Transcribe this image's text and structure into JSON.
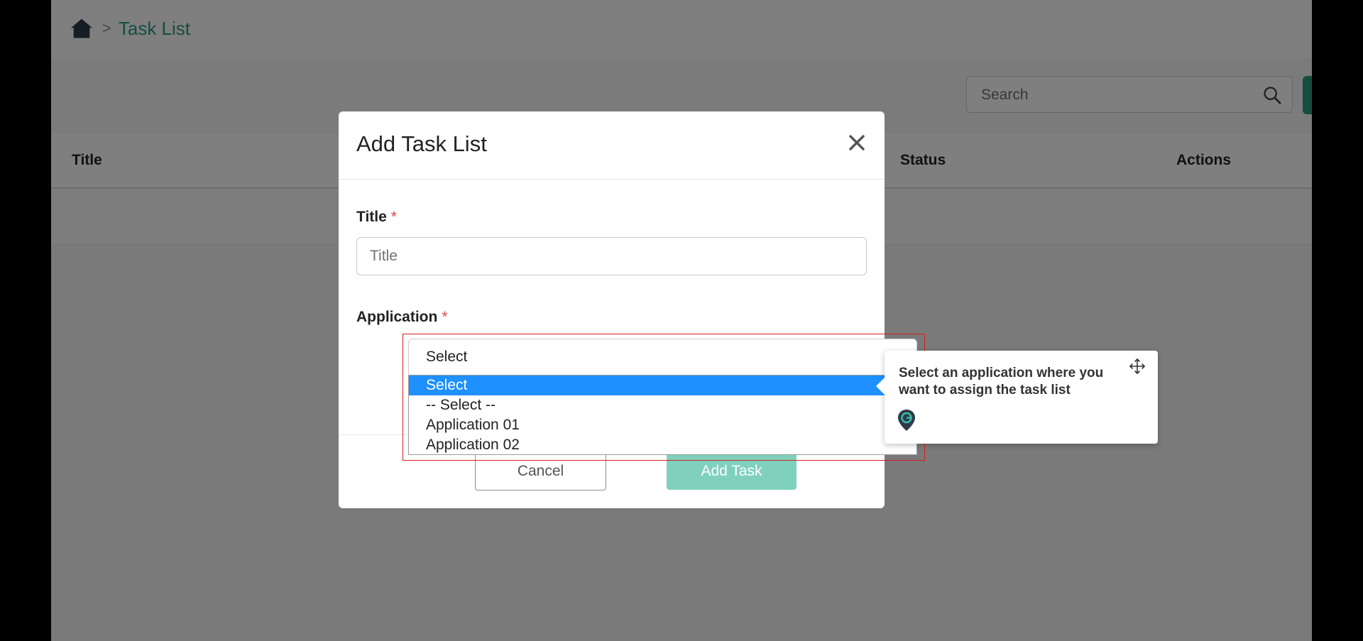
{
  "breadcrumb": {
    "current": "Task List",
    "separator": ">"
  },
  "search": {
    "placeholder": "Search"
  },
  "table": {
    "columns": [
      "Title",
      "Status",
      "Actions"
    ]
  },
  "modal": {
    "title": "Add Task List",
    "close_symbol": "✕",
    "fields": {
      "title": {
        "label": "Title",
        "required_marker": "*",
        "placeholder": "Title",
        "value": ""
      },
      "application": {
        "label": "Application",
        "required_marker": "*",
        "selected": "Select",
        "options": [
          "Select",
          "-- Select --",
          "Application 01",
          "Application 02"
        ]
      }
    },
    "buttons": {
      "cancel": "Cancel",
      "submit": "Add Task"
    }
  },
  "tooltip": {
    "text": "Select an application where you want to assign the task list"
  },
  "colors": {
    "accent": "#2a9d7f",
    "accent_light": "#7fd1be",
    "selected_option": "#1e90ff",
    "required": "#e04545",
    "highlight": "#d21f1f"
  }
}
